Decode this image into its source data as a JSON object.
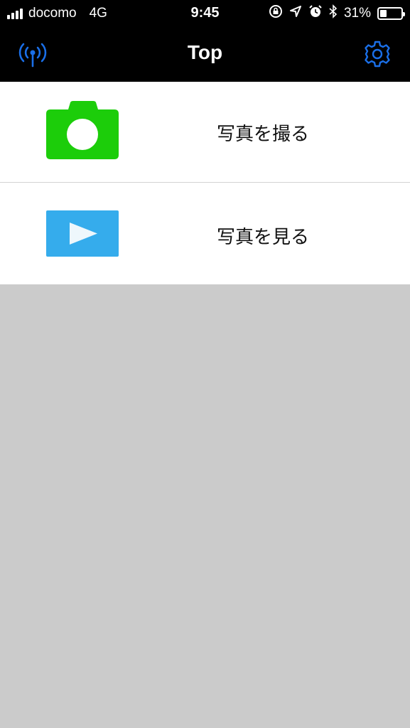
{
  "status_bar": {
    "carrier": "docomo",
    "network": "4G",
    "time": "9:45",
    "battery_percent": "31%",
    "battery_level": 0.31
  },
  "nav_bar": {
    "title": "Top",
    "left_icon": "antenna-icon",
    "right_icon": "gear-icon",
    "accent_color": "#1a6fe8"
  },
  "menu": {
    "items": [
      {
        "label": "写真を撮る",
        "icon": "camera-icon",
        "icon_color": "#1ccd0a"
      },
      {
        "label": "写真を見る",
        "icon": "play-icon",
        "icon_color": "#35acec"
      }
    ]
  }
}
